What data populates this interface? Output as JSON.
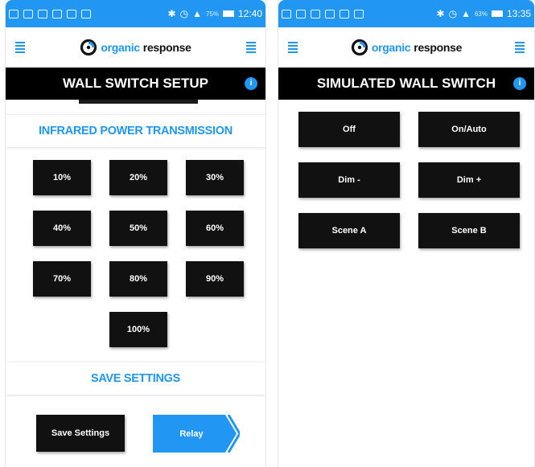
{
  "colors": {
    "accent": "#2196f3",
    "bar": "#000000",
    "button": "#111111"
  },
  "left_screen": {
    "status_bar": {
      "battery": "75%",
      "time": "12:40"
    },
    "logo": {
      "word1": "organic",
      "word2": "response"
    },
    "title": "WALL SWITCH SETUP",
    "ir_section": {
      "heading": "INFRARED POWER TRANSMISSION",
      "buttons": [
        "10%",
        "20%",
        "30%",
        "40%",
        "50%",
        "60%",
        "70%",
        "80%",
        "90%",
        "100%"
      ]
    },
    "save_section": {
      "heading": "SAVE SETTINGS",
      "save_button": "Save Settings",
      "relay_button": "Relay"
    }
  },
  "right_screen": {
    "status_bar": {
      "battery": "63%",
      "time": "13:35"
    },
    "logo": {
      "word1": "organic",
      "word2": "response"
    },
    "title": "SIMULATED WALL SWITCH",
    "buttons": [
      "Off",
      "On/Auto",
      "Dim -",
      "Dim +",
      "Scene A",
      "Scene B"
    ]
  },
  "icons": [
    "hamburger-menu-icon",
    "organic-response-logo-icon",
    "info-icon",
    "wifi-icon",
    "signal-icon",
    "battery-icon",
    "bluetooth-icon",
    "alarm-icon"
  ]
}
